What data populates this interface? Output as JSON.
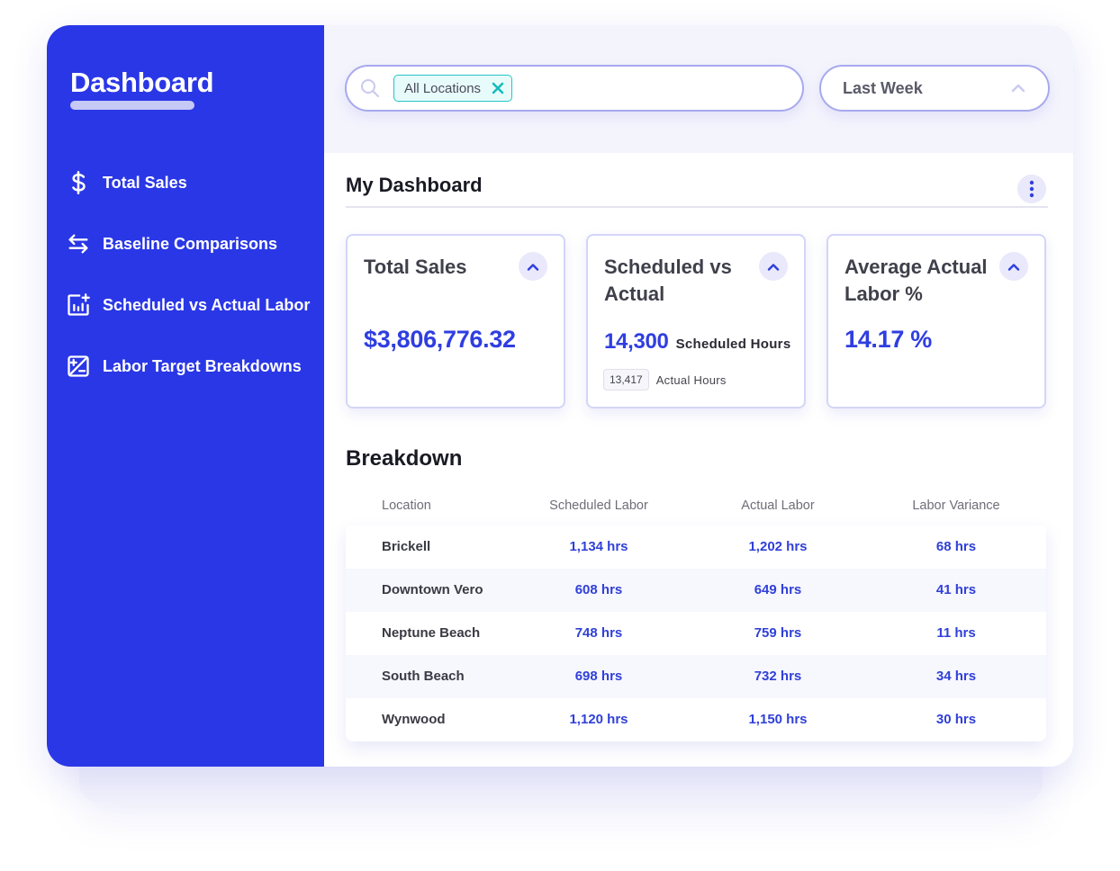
{
  "sidebar": {
    "title": "Dashboard",
    "items": [
      {
        "label": "Total Sales",
        "icon": "dollar-icon"
      },
      {
        "label": "Baseline Comparisons",
        "icon": "swap-arrows-icon"
      },
      {
        "label": "Scheduled vs Actual Labor",
        "icon": "chart-plus-icon"
      },
      {
        "label": "Labor Target Breakdowns",
        "icon": "plus-minus-icon"
      }
    ]
  },
  "filters": {
    "search_icon": "search-icon",
    "chip_label": "All Locations",
    "period_label": "Last Week"
  },
  "dashboard": {
    "title": "My Dashboard",
    "cards": [
      {
        "title": "Total Sales",
        "value": "$3,806,776.32"
      },
      {
        "title": "Scheduled vs Actual",
        "value": "14,300",
        "value_label": "Scheduled Hours",
        "secondary_value": "13,417",
        "secondary_label": "Actual Hours"
      },
      {
        "title": "Average Actual Labor %",
        "value": "14.17 %"
      }
    ]
  },
  "breakdown": {
    "title": "Breakdown",
    "columns": [
      "Location",
      "Scheduled Labor",
      "Actual Labor",
      "Labor Variance"
    ],
    "rows": [
      [
        "Brickell",
        "1,134 hrs",
        "1,202 hrs",
        "68 hrs"
      ],
      [
        "Downtown Vero",
        "608 hrs",
        "649 hrs",
        "41 hrs"
      ],
      [
        "Neptune Beach",
        "748 hrs",
        "759 hrs",
        "11 hrs"
      ],
      [
        "South Beach",
        "698 hrs",
        "732 hrs",
        "34 hrs"
      ],
      [
        "Wynwood",
        "1,120 hrs",
        "1,150 hrs",
        "30 hrs"
      ]
    ]
  },
  "colors": {
    "sidebar": "#2a37e6",
    "accent": "#2f3ee0",
    "chip_border": "#26c4c4"
  }
}
